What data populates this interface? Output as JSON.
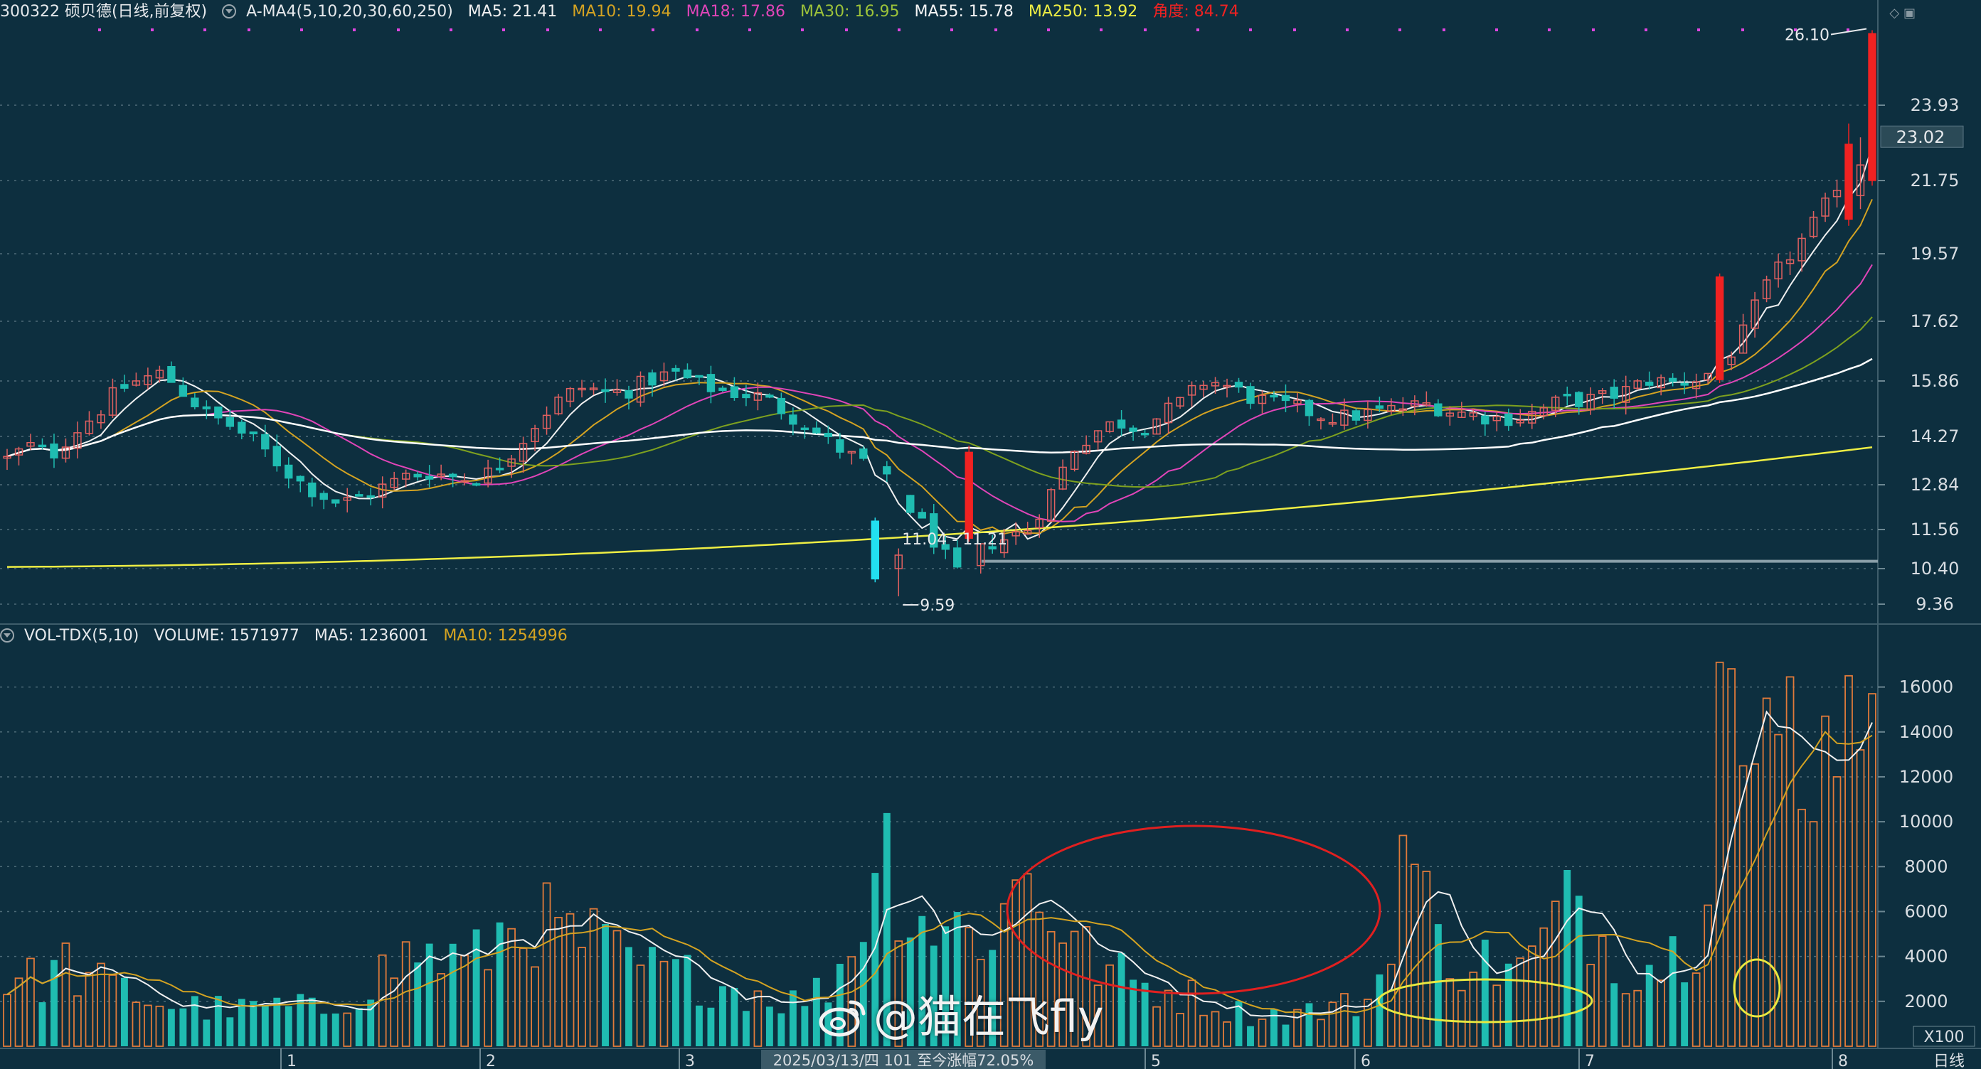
{
  "header": {
    "title": "300322 硕贝德(日线,前复权)",
    "indicator": "A-MA4(5,10,20,30,60,250)",
    "ma5": "MA5: 21.41",
    "ma10": "MA10: 19.94",
    "ma18": "MA18: 17.86",
    "ma30": "MA30: 16.95",
    "ma55": "MA55: 15.78",
    "ma250": "MA250: 13.92",
    "angle": "角度: 84.74"
  },
  "vol_header": {
    "indicator": "VOL-TDX(5,10)",
    "volume": "VOLUME: 1571977",
    "ma5": "MA5: 1236001",
    "ma10": "MA10: 1254996"
  },
  "colors": {
    "bg": "#0d2f3f",
    "up": "#f02222",
    "down": "#1fbcb1",
    "ma5": "#f0f0f0",
    "ma10": "#d4a322",
    "ma18": "#e045b8",
    "ma30": "#7ea11f",
    "ma55": "#ffffff",
    "ma250": "#eeee44",
    "volma10": "#d4a322"
  },
  "chart_data": {
    "type": "candlestick",
    "price_axis_labels": [
      "23.93",
      "21.75",
      "19.57",
      "17.62",
      "15.86",
      "14.27",
      "12.84",
      "11.56",
      "10.40",
      "9.36"
    ],
    "price_axis_ylim": [
      9.0,
      27.0
    ],
    "current_price_tag": "23.02",
    "annotations": {
      "high": "26.10",
      "low": "9.59",
      "range": "11.04 - 11.21"
    },
    "volume_axis_labels": [
      "16000",
      "14000",
      "12000",
      "10000",
      "8000",
      "6000",
      "4000",
      "2000"
    ],
    "volume_unit": "X100",
    "x_month_labels": [
      "1",
      "2",
      "3",
      "5",
      "6",
      "7",
      "8"
    ],
    "period_label": "日线",
    "status_text": "2025/03/13/四 101 至今涨幅72.05%",
    "note": "",
    "price_seed": [
      13.6,
      14.0,
      13.7,
      14.4,
      14.9,
      15.6,
      15.9,
      16.1,
      15.5,
      14.9,
      14.6,
      14.2,
      13.6,
      13.0,
      12.6,
      12.3,
      12.5,
      12.8,
      13.1,
      13.2,
      13.1,
      13.0,
      13.3,
      14.0,
      14.8,
      15.4,
      15.7,
      15.5,
      15.6,
      15.9,
      16.1,
      15.8,
      15.6,
      15.5,
      15.4,
      15.0,
      14.6,
      14.1,
      13.7,
      13.3,
      12.7,
      11.9,
      11.0,
      10.0,
      11.1,
      11.3,
      11.6,
      12.6,
      13.9,
      14.4,
      14.7,
      14.5,
      14.9,
      15.3,
      15.9,
      15.7,
      15.4,
      15.2,
      15.1,
      14.9,
      14.8,
      14.9,
      15.0,
      15.1,
      15.2,
      15.0,
      14.9,
      14.8,
      14.8,
      15.0,
      15.3,
      15.3,
      15.4,
      15.6,
      15.9,
      15.8,
      15.9,
      16.2,
      17.0,
      18.4,
      19.3,
      20.1,
      21.1,
      22.4,
      23.9
    ],
    "volume_seed": [
      3000,
      2900,
      3600,
      2800,
      2500,
      2000,
      1800,
      1700,
      1600,
      1800,
      1700,
      1600,
      2500,
      3400,
      4200,
      3900,
      3700,
      5100,
      5800,
      4800,
      4700,
      3900,
      3400,
      3200,
      2900,
      2600,
      2300,
      2000,
      2500,
      4400,
      9500,
      6200,
      5400,
      5100,
      5400,
      7800,
      5900,
      4100,
      3200,
      2700,
      2400,
      2100,
      1600,
      1400,
      1500,
      1600,
      1800,
      2300,
      9500,
      4700,
      3800,
      3700,
      3300,
      5200,
      6700,
      4100,
      3600,
      3900,
      5400,
      17000,
      10400,
      14900,
      12000,
      13000,
      15600
    ]
  }
}
